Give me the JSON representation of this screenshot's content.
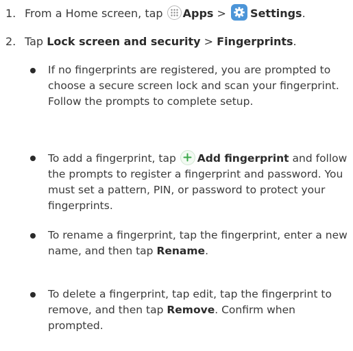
{
  "steps": [
    {
      "number": "1.",
      "prefix": "From a Home screen, tap",
      "apps_icon": "apps-grid-icon",
      "apps_label": "Apps",
      "separator": ">",
      "settings_icon": "settings-gear-icon",
      "settings_label": "Settings",
      "end": "."
    },
    {
      "number": "2.",
      "prefix": "Tap",
      "lock_label": "Lock screen and security",
      "separator": ">",
      "fingerprints_label": "Fingerprints",
      "end": "."
    }
  ],
  "bullets": [
    {
      "text": "If no fingerprints are registered, you are prompted to choose a secure screen lock and scan your fingerprint. Follow the prompts to complete setup."
    },
    {
      "before": "To add a fingerprint, tap",
      "icon": "plus-circle-icon",
      "bold": "Add fingerprint",
      "after": "and follow the prompts to register a fingerprint and password. You must set a pattern, PIN, or password to protect your fingerprints."
    },
    {
      "before": "To rename a fingerprint, tap the fingerprint, enter a new name, and then tap",
      "bold": "Rename",
      "after": "."
    },
    {
      "before": "To delete a fingerprint, tap edit, tap the fingerprint to remove, and then tap",
      "bold": "Remove",
      "after": ". Confirm when prompted."
    }
  ],
  "colors": {
    "text": "#3a3a3a",
    "settings_icon_bg": "#4c95d8",
    "add_icon": "#3aa84a"
  }
}
